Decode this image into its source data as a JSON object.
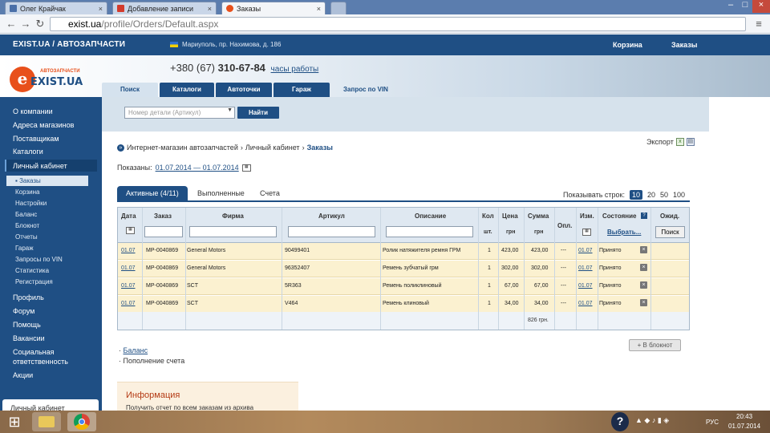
{
  "browser": {
    "tabs": [
      {
        "label": "Олег Крайчак"
      },
      {
        "label": "Добавление записи"
      },
      {
        "label": "Заказы"
      }
    ],
    "url_host": "exist.ua",
    "url_path": "/profile/Orders/Default.aspx"
  },
  "site": {
    "brand": "EXIST.UA / АВТОЗАПЧАСТИ",
    "location": "Мариуполь, пр. Нахимова, д. 186",
    "cart_label": "Корзина",
    "orders_label": "Заказы",
    "phone_prefix": "+380 (67)",
    "phone_number": "310-67-84",
    "hours_link": "часы работы",
    "logo_letter": "e",
    "logo_brand": "EXIST.UA",
    "logo_sub": "АВТОЗАПЧАСТИ",
    "search_tabs": [
      "Поиск",
      "Каталоги",
      "Автоточки",
      "Гараж",
      "Запрос по VIN »"
    ],
    "search_placeholder": "Номер детали (Артикул)",
    "find_button": "Найти"
  },
  "sidebar": {
    "items": [
      "О компании",
      "Адреса магазинов",
      "Поставщикам",
      "Каталоги",
      "Личный кабинет"
    ],
    "subitems": [
      "Заказы",
      "Корзина",
      "Настройки",
      "Баланс",
      "Блокнот",
      "Отчеты",
      "Гараж",
      "Запросы по VIN",
      "Статистика",
      "Регистрация"
    ],
    "bottom_items": [
      "Профиль",
      "Форум",
      "Помощь",
      "Вакансии",
      "Социальная",
      "ответственность",
      "Акции"
    ],
    "footer_box": "Личный кабинет"
  },
  "main": {
    "breadcrumb": [
      "Интернет-магазин автозапчастей",
      "Личный кабинет",
      "Заказы"
    ],
    "export_label": "Экспорт",
    "shown_label": "Показаны:",
    "shown_range": "01.07.2014 — 01.07.2014",
    "filter_tabs": [
      "Активные (4/11)",
      "Выполненные",
      "Счета"
    ],
    "rows_label": "Показывать строк:",
    "rows_options": [
      "10",
      "20",
      "50",
      "100"
    ],
    "columns": [
      "Дата",
      "Заказ",
      "Фирма",
      "Артикул",
      "Описание",
      "Кол",
      "Цена",
      "Сумма",
      "Опл.",
      "Изм.",
      "Состояние",
      "Ожид."
    ],
    "columns_sub": {
      "qty": "шт.",
      "price": "грн",
      "sum": "грн"
    },
    "status_select": "Выбрать...",
    "search_button": "Поиск",
    "rows": [
      {
        "date": "01.07",
        "order": "MP-0040869",
        "firm": "General Motors",
        "article": "90499401",
        "desc": "Ролик натяжителя ремня ГРМ",
        "qty": "1",
        "price": "423,00",
        "sum": "423,00",
        "paid": "---",
        "changed": "01.07",
        "status": "Принято"
      },
      {
        "date": "01.07",
        "order": "MP-0040869",
        "firm": "General Motors",
        "article": "96352407",
        "desc": "Ремень зубчатый грм",
        "qty": "1",
        "price": "302,00",
        "sum": "302,00",
        "paid": "---",
        "changed": "01.07",
        "status": "Принято"
      },
      {
        "date": "01.07",
        "order": "MP-0040869",
        "firm": "SCT",
        "article": "5R363",
        "desc": "Ремень поликлиновый",
        "qty": "1",
        "price": "67,00",
        "sum": "67,00",
        "paid": "---",
        "changed": "01.07",
        "status": "Принято"
      },
      {
        "date": "01.07",
        "order": "MP-0040869",
        "firm": "SCT",
        "article": "V464",
        "desc": "Ремень клиновый",
        "qty": "1",
        "price": "34,00",
        "sum": "34,00",
        "paid": "---",
        "changed": "01.07",
        "status": "Принято"
      }
    ],
    "total": "826 грн.",
    "notebook_button": "+ В блокнот",
    "links": [
      "Баланс",
      "Пополнение счета"
    ],
    "info_title": "Информация",
    "info_text": "Получить отчет по всем заказам из архива"
  },
  "taskbar": {
    "lang": "РУС",
    "time": "20:43",
    "date": "01.07.2014"
  },
  "colors": {
    "brand_blue": "#1f4f84",
    "row_yellow": "#fbf1d0",
    "accent_orange": "#e8501b"
  }
}
